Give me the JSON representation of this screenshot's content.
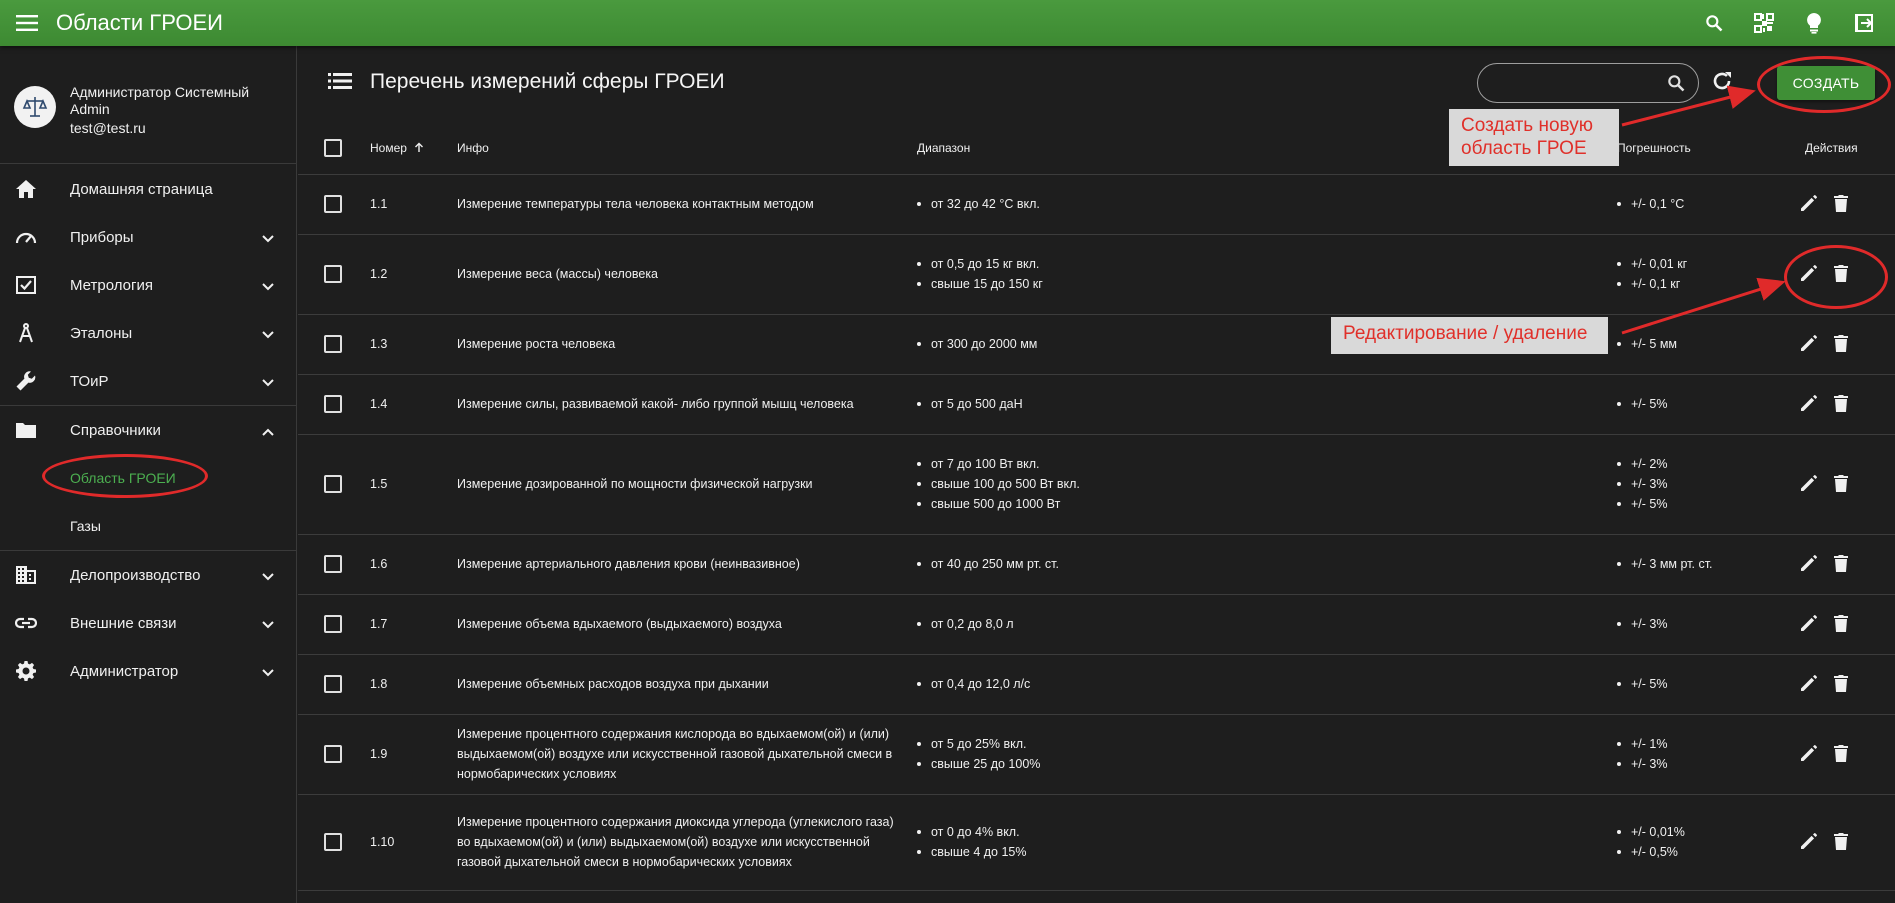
{
  "appbar": {
    "title": "Области ГРОЕИ",
    "icons": [
      "menu-icon",
      "search-icon",
      "qr-code-icon",
      "lightbulb-icon",
      "logout-icon"
    ]
  },
  "profile": {
    "name": "Администратор Системный Admin",
    "email": "test@test.ru"
  },
  "nav": {
    "home": "Домашняя страница",
    "devices": "Приборы",
    "metrology": "Метрология",
    "etalons": "Эталоны",
    "toir": "ТОиР",
    "handbooks": "Справочники",
    "handbooks_children": [
      "Область ГРОЕИ",
      "Газы"
    ],
    "records": "Делопроизводство",
    "external": "Внешние связи",
    "admin": "Администратор"
  },
  "main": {
    "title": "Перечень измерений сферы ГРОЕИ",
    "search_value": "",
    "create_label": "СОЗДАТЬ"
  },
  "table": {
    "headers": {
      "number": "Номер",
      "info": "Инфо",
      "range": "Диапазон",
      "error": "Погрешность",
      "actions": "Действия"
    },
    "sort": "number-asc",
    "rows": [
      {
        "num": "1.1",
        "info": "Измерение температуры тела человека контактным методом",
        "ranges": [
          "от 32 до 42 °С вкл."
        ],
        "errors": [
          "+/- 0,1 °С"
        ]
      },
      {
        "num": "1.2",
        "info": "Измерение веса (массы) человека",
        "ranges": [
          "от 0,5 до 15 кг вкл.",
          "свыше 15 до 150 кг"
        ],
        "errors": [
          "+/- 0,01 кг",
          "+/- 0,1 кг"
        ]
      },
      {
        "num": "1.3",
        "info": "Измерение роста человека",
        "ranges": [
          "от 300 до 2000 мм"
        ],
        "errors": [
          "+/- 5 мм"
        ]
      },
      {
        "num": "1.4",
        "info": "Измерение силы, развиваемой какой- либо группой мышц человека",
        "ranges": [
          "от 5 до 500 даН"
        ],
        "errors": [
          "+/- 5%"
        ]
      },
      {
        "num": "1.5",
        "info": "Измерение дозированной по мощности физической нагрузки",
        "ranges": [
          "от 7 до 100 Вт вкл.",
          "свыше 100 до 500 Вт вкл.",
          "свыше 500 до 1000 Вт"
        ],
        "errors": [
          "+/- 2%",
          "+/- 3%",
          "+/- 5%"
        ]
      },
      {
        "num": "1.6",
        "info": "Измерение артериального давления крови (неинвазивное)",
        "ranges": [
          "от 40 до 250 мм рт. ст."
        ],
        "errors": [
          "+/- 3 мм рт. ст."
        ]
      },
      {
        "num": "1.7",
        "info": "Измерение объема вдыхаемого (выдыхаемого) воздуха",
        "ranges": [
          "от 0,2 до 8,0 л"
        ],
        "errors": [
          "+/- 3%"
        ]
      },
      {
        "num": "1.8",
        "info": "Измерение объемных расходов воздуха при дыхании",
        "ranges": [
          "от 0,4 до 12,0 л/с"
        ],
        "errors": [
          "+/- 5%"
        ]
      },
      {
        "num": "1.9",
        "info": "Измерение процентного содержания кислорода во вдыхаемом(ой) и (или) выдыхаемом(ой) воздухе или искусственной газовой дыхательной смеси в нормобарических условиях",
        "ranges": [
          "от 5 до 25% вкл.",
          "свыше 25 до 100%"
        ],
        "errors": [
          "+/- 1%",
          "+/- 3%"
        ]
      },
      {
        "num": "1.10",
        "info": "Измерение процентного содержания диоксида углерода (углекислого газа) во вдыхаемом(ой) и (или) выдыхаемом(ой) воздухе или искусственной газовой дыхательной смеси в нормобарических условиях",
        "ranges": [
          "от 0 до 4% вкл.",
          "свыше 4 до 15%"
        ],
        "errors": [
          "+/- 0,01%",
          "+/- 0,5%"
        ]
      }
    ]
  },
  "annotations": {
    "create_note": "Создать новую\nобласть ГРОЕ",
    "edit_note": "Редактирование / удаление",
    "color": "#e02a2a"
  },
  "colors": {
    "appbar": "#3d8a32",
    "accent": "#4caf50",
    "background": "#1e1e1e"
  }
}
